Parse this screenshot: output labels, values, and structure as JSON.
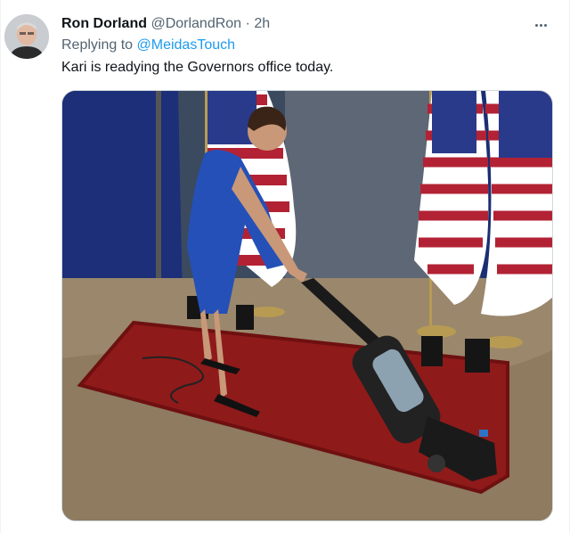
{
  "author": {
    "name": "Ron Dorland",
    "handle": "@DorlandRon",
    "separator": "·",
    "time": "2h",
    "avatar_icon": "user-avatar"
  },
  "reply": {
    "prefix": "Replying to ",
    "mention": "@MeidasTouch"
  },
  "tweet_text": "Kari is readying the Governors office today.",
  "media": {
    "description_icon": "photo"
  },
  "colors": {
    "link": "#1d9bf0",
    "secondary_text": "#536471",
    "primary_text": "#0f1419"
  }
}
